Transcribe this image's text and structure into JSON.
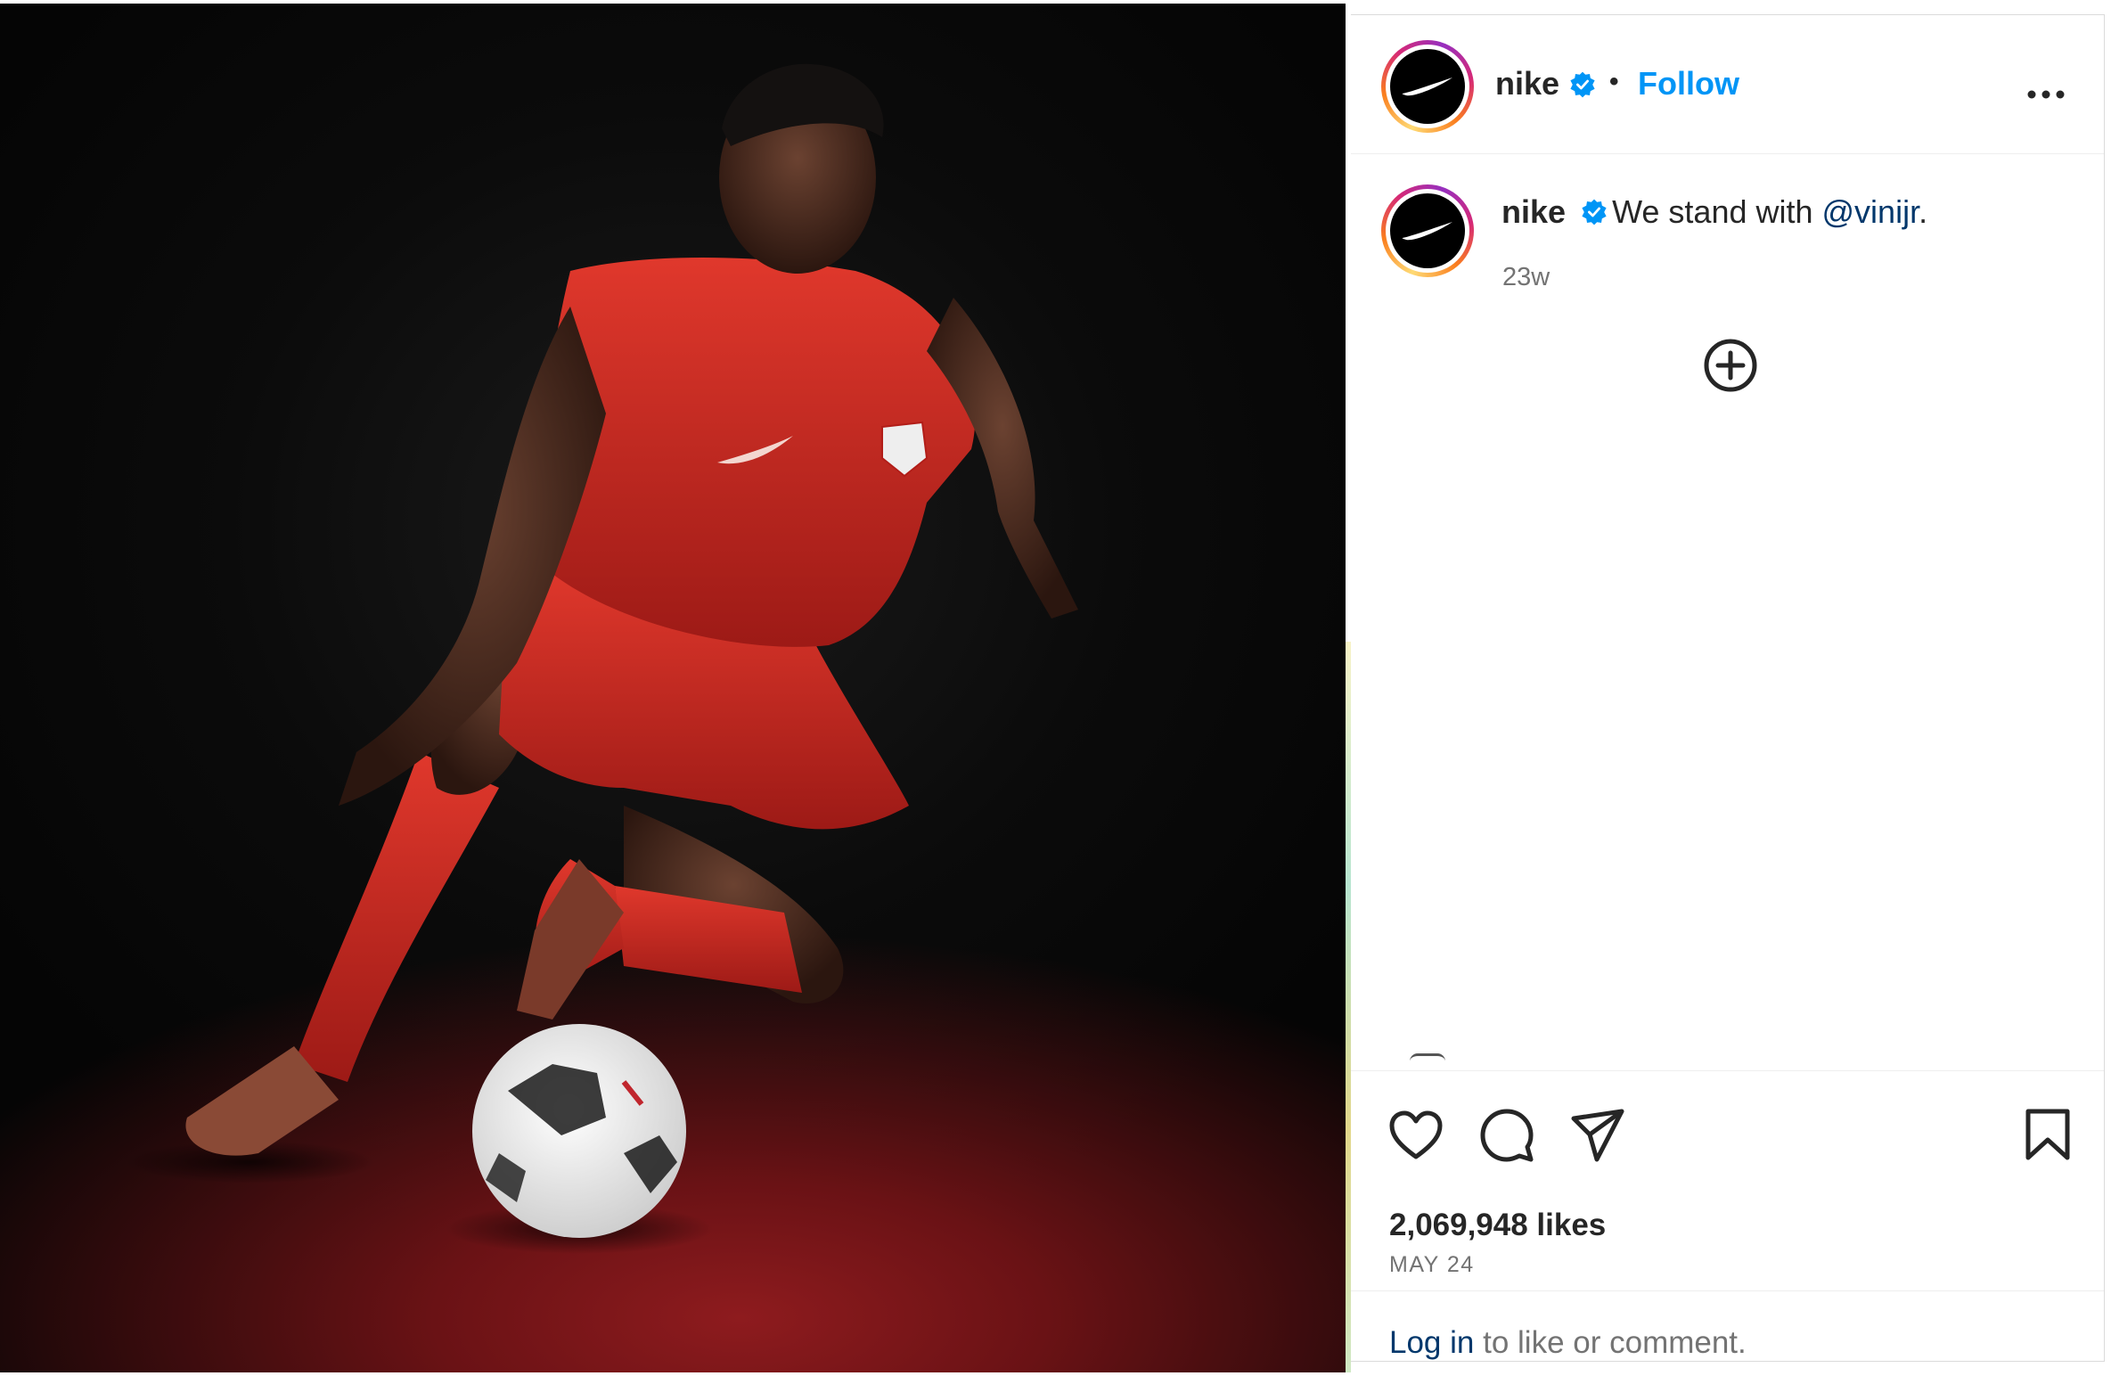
{
  "post": {
    "image_alt": "Soccer player in red kit dribbling a ball",
    "account": {
      "username": "nike",
      "verified": true
    },
    "header": {
      "separator": "•",
      "follow_label": "Follow"
    },
    "caption": {
      "username": "nike",
      "text_before": "We stand with ",
      "mention": "@vinijr",
      "text_after": ".",
      "time_ago": "23w"
    },
    "stats": {
      "likes_label": "2,069,948 likes",
      "date": "MAY 24"
    },
    "footer": {
      "login_link": "Log in",
      "login_rest": " to like or comment."
    }
  },
  "icons": {
    "more": "more-options-icon",
    "verified": "verified-badge-icon",
    "plus": "plus-circle-icon",
    "like": "heart-icon",
    "comment": "comment-icon",
    "share": "share-icon",
    "save": "bookmark-icon"
  },
  "colors": {
    "follow": "#0095f6",
    "verified": "#0095f6",
    "mention": "#00376b",
    "kit_red": "#c9261f"
  }
}
